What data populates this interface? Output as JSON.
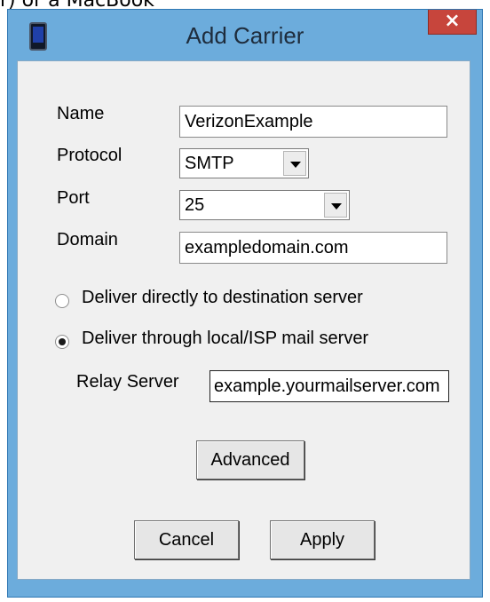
{
  "clipped_text": "r) or a MacBook",
  "window": {
    "title": "Add Carrier",
    "close_glyph": "×"
  },
  "form": {
    "name_label": "Name",
    "name_value": "VerizonExample",
    "protocol_label": "Protocol",
    "protocol_value": "SMTP",
    "port_label": "Port",
    "port_value": "25",
    "domain_label": "Domain",
    "domain_value": "exampledomain.com"
  },
  "delivery": {
    "option_direct": "Deliver directly to destination server",
    "option_relay": "Deliver through local/ISP mail server",
    "selected": "relay",
    "relay_label": "Relay Server",
    "relay_value": "example.yourmailserver.com"
  },
  "buttons": {
    "advanced": "Advanced",
    "cancel": "Cancel",
    "apply": "Apply"
  },
  "icons": {
    "title": "phone-icon",
    "dropdown": "chevron-down-icon"
  }
}
